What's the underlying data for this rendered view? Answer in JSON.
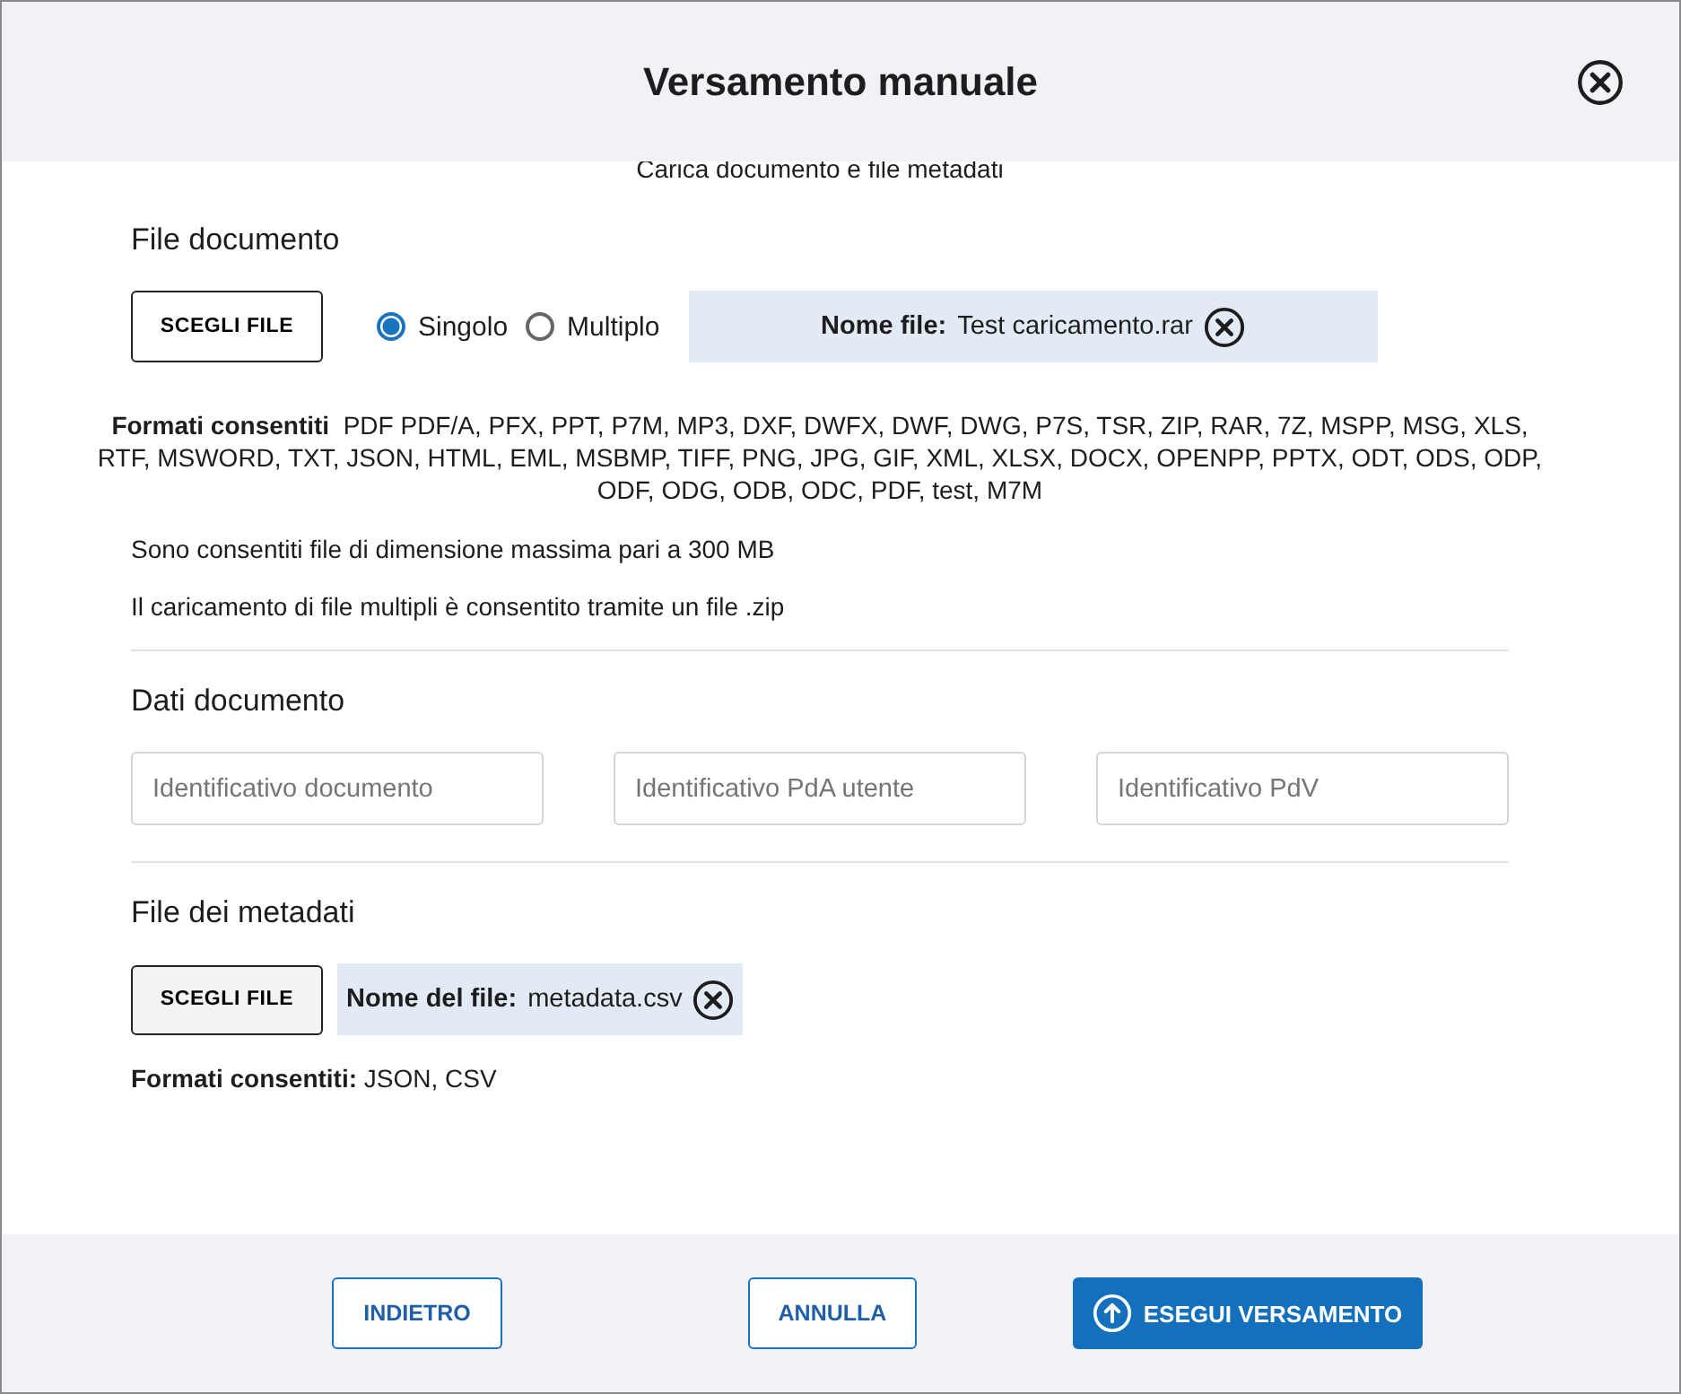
{
  "window": {
    "title": "Versamento manuale"
  },
  "subtitle": "Carica documento e file metadati",
  "document_file": {
    "heading": "File documento",
    "choose_button": "SCEGLI FILE",
    "modes": [
      {
        "label": "Singolo",
        "selected": true
      },
      {
        "label": "Multiplo",
        "selected": false
      }
    ],
    "file_label": "Nome file:",
    "file_name": "Test caricamento.rar",
    "formats_label": "Formati consentiti",
    "formats": "PDF PDF/A, PFX, PPT, P7M, MP3, DXF, DWFX, DWF, DWG, P7S, TSR, ZIP, RAR, 7Z, MSPP, MSG, XLS, RTF, MSWORD, TXT, JSON, HTML, EML, MSBMP, TIFF, PNG, JPG, GIF, XML, XLSX, DOCX, OPENPP, PPTX, ODT, ODS, ODP, ODF, ODG, ODB, ODC, PDF, test, M7M",
    "notes": [
      "Sono consentiti file di dimensione massima pari a 300 MB",
      "Il caricamento di file multipli è consentito tramite un file .zip"
    ]
  },
  "document_data": {
    "heading": "Dati documento",
    "fields": [
      {
        "placeholder": "Identificativo documento"
      },
      {
        "placeholder": "Identificativo PdA utente"
      },
      {
        "placeholder": "Identificativo PdV"
      }
    ]
  },
  "metadata_file": {
    "heading": "File dei metadati",
    "choose_button": "SCEGLI FILE",
    "file_label": "Nome del file:",
    "file_name": "metadata.csv",
    "formats_label": "Formati consentiti:",
    "formats": "JSON, CSV"
  },
  "buttons": [
    {
      "label": "INDIETRO",
      "kind": "outline"
    },
    {
      "label": "ANNULLA",
      "kind": "outline"
    },
    {
      "label": "ESEGUI VERSAMENTO",
      "kind": "primary"
    }
  ]
}
